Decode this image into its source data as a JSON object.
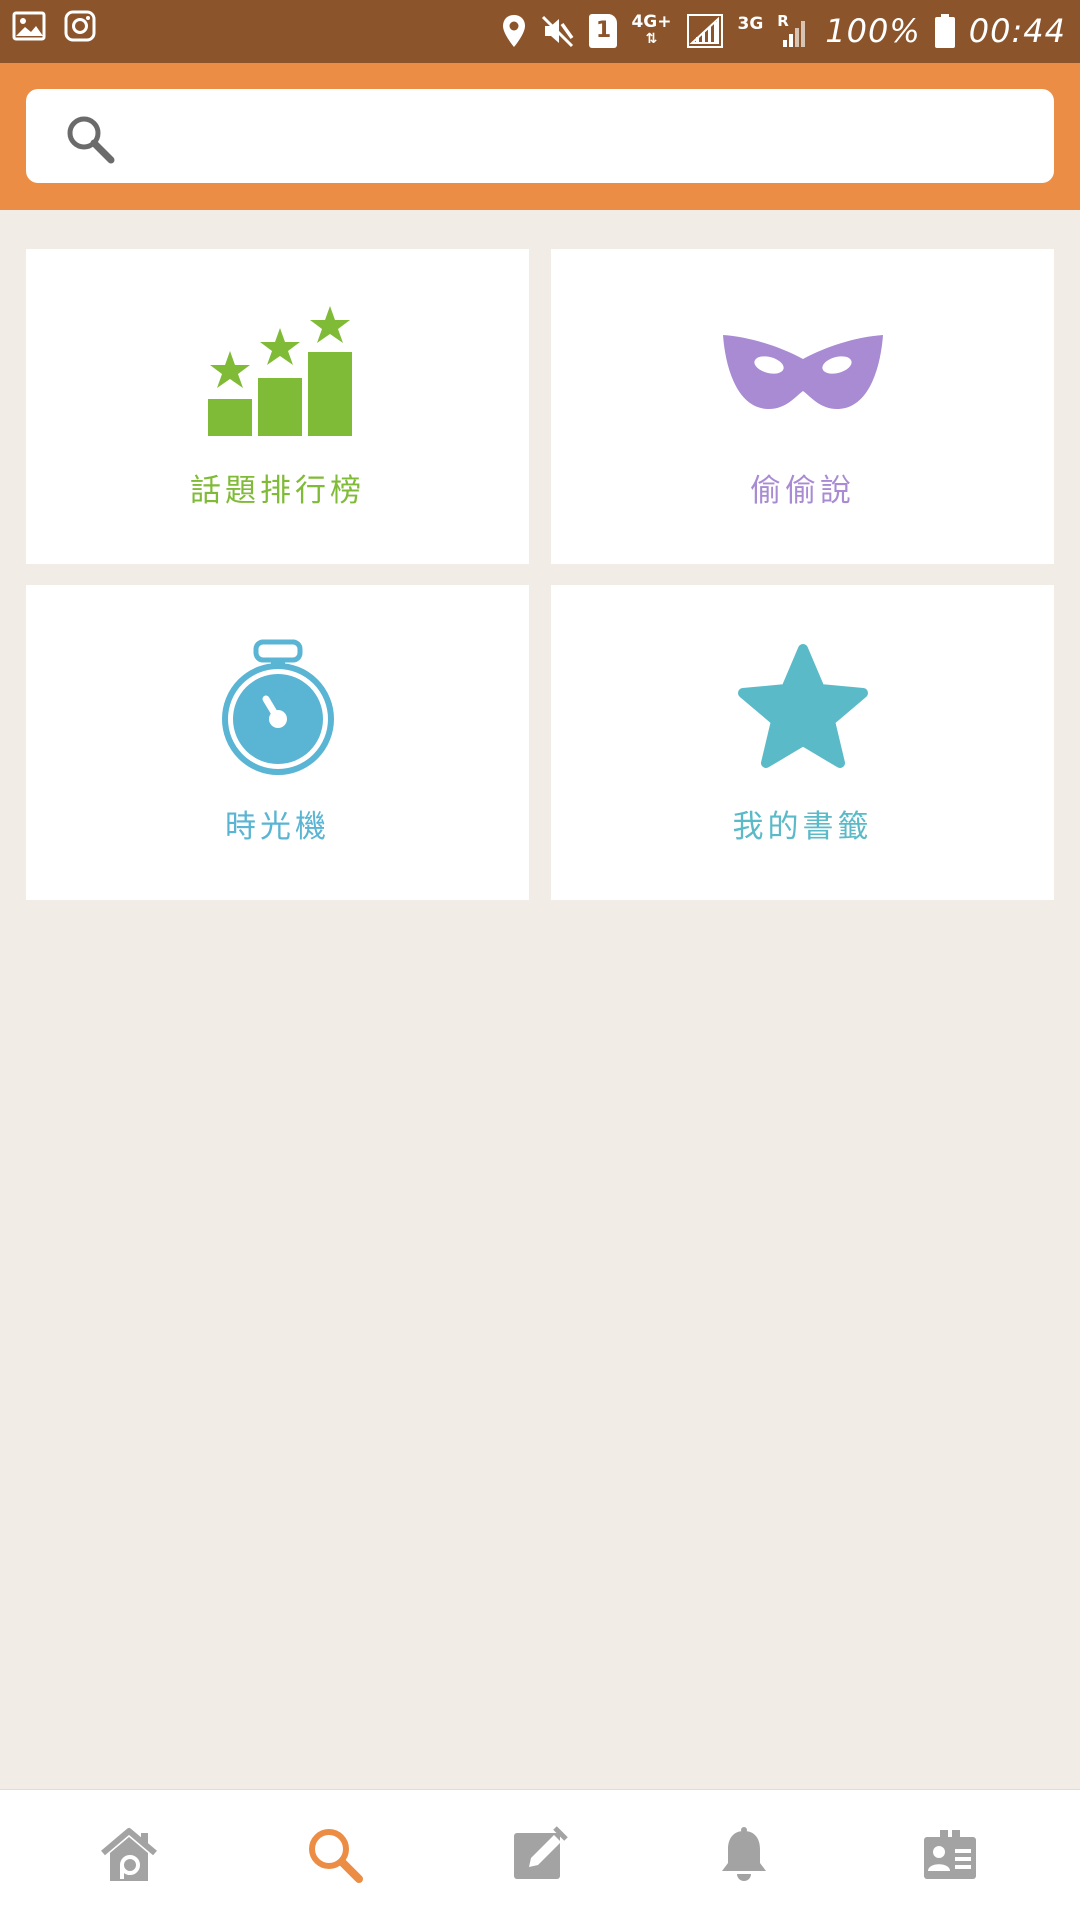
{
  "status_bar": {
    "network_type": "4G+",
    "secondary_network": "3G",
    "roaming": "R",
    "battery": "100%",
    "time": "00:44",
    "sim_slot": "1",
    "colors": {
      "background": "#8b542b"
    }
  },
  "search": {
    "placeholder": "",
    "value": "",
    "colors": {
      "background": "#ec8d45"
    }
  },
  "menu_cards": [
    {
      "label": "話題排行榜",
      "icon": "ranking-stars-icon",
      "color": "#80bb37"
    },
    {
      "label": "偷偷說",
      "icon": "mask-icon",
      "color": "#a98bd3"
    },
    {
      "label": "時光機",
      "icon": "stopwatch-icon",
      "color": "#5ab4d3"
    },
    {
      "label": "我的書籤",
      "icon": "star-icon",
      "color": "#5bbac8"
    }
  ],
  "bottom_nav": {
    "items": [
      {
        "icon": "home-icon",
        "active": false
      },
      {
        "icon": "search-icon",
        "active": true
      },
      {
        "icon": "compose-icon",
        "active": false
      },
      {
        "icon": "bell-icon",
        "active": false
      },
      {
        "icon": "profile-card-icon",
        "active": false
      }
    ],
    "colors": {
      "active": "#ec8d45",
      "inactive": "#a3a3a3"
    }
  }
}
